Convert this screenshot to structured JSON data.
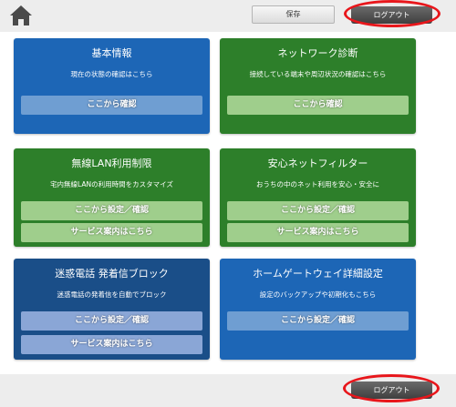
{
  "header": {
    "save_label": "保存",
    "logout_label": "ログアウト"
  },
  "cards": [
    {
      "title": "基本情報",
      "desc": "現在の状態の確認はこちら",
      "buttons": [
        "ここから確認"
      ]
    },
    {
      "title": "ネットワーク診断",
      "desc": "接続している端末や周辺状況の確認はこちら",
      "buttons": [
        "ここから確認"
      ]
    },
    {
      "title": "無線LAN利用制限",
      "desc": "宅内無線LANの利用時間をカスタマイズ",
      "buttons": [
        "ここから設定／確認",
        "サービス案内はこちら"
      ]
    },
    {
      "title": "安心ネットフィルター",
      "desc": "おうちの中のネット利用を安心・安全に",
      "buttons": [
        "ここから設定／確認",
        "サービス案内はこちら"
      ]
    },
    {
      "title": "迷惑電話 発着信ブロック",
      "desc": "迷惑電話の発着信を自動でブロック",
      "buttons": [
        "ここから設定／確認",
        "サービス案内はこちら"
      ]
    },
    {
      "title": "ホームゲートウェイ詳細設定",
      "desc": "設定のバックアップや初期化もこちら",
      "buttons": [
        "ここから設定／確認"
      ]
    }
  ],
  "footer": {
    "logout_label": "ログアウト"
  },
  "colors": {
    "blue": "#1d66b6",
    "green": "#2d7f2a",
    "navy": "#1a4e88",
    "highlight": "#e8161b"
  },
  "icons": {
    "home": "home-icon"
  }
}
